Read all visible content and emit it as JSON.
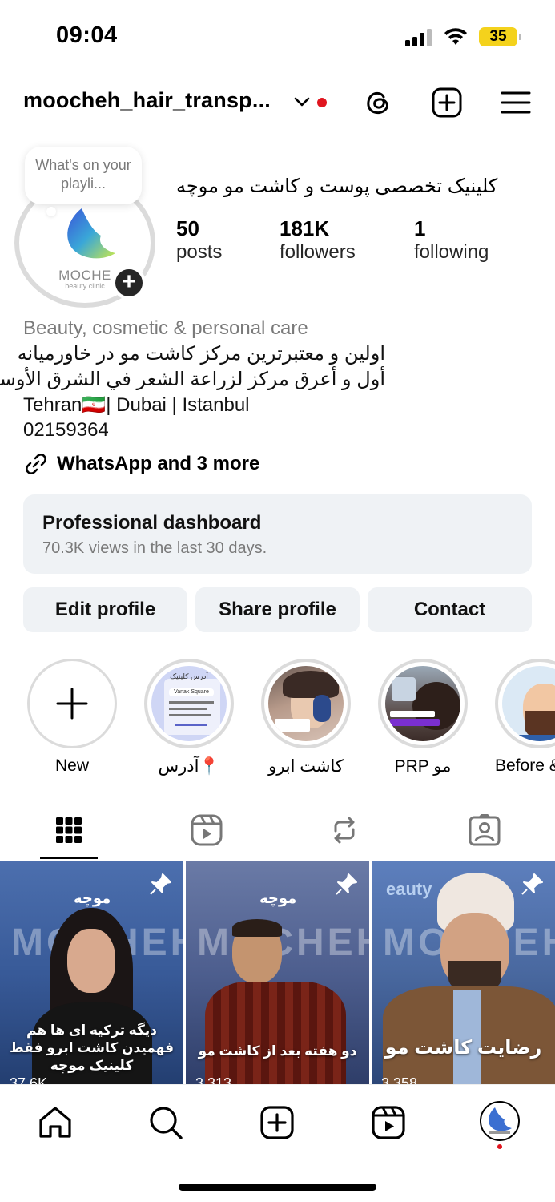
{
  "status_bar": {
    "time": "09:04",
    "battery": "35"
  },
  "header": {
    "username": "moocheh_hair_transp...",
    "icons": [
      "chevron-down-icon",
      "threads-icon",
      "create-post-icon",
      "menu-icon"
    ],
    "notification_color": "#e0151f"
  },
  "profile": {
    "note_bubble": "What's on your playli...",
    "avatar_brand": "MOCHE",
    "avatar_subtitle": "beauty clinic",
    "full_name": "کلینیک تخصصی پوست و کاشت مو موچه",
    "stats": [
      {
        "value": "50",
        "label": "posts"
      },
      {
        "value": "181K",
        "label": "followers"
      },
      {
        "value": "1",
        "label": "following"
      }
    ],
    "category": "Beauty, cosmetic & personal care",
    "bio_lines": [
      "اولین و معتبرترین مرکز کاشت مو در خاورمیانه",
      "أول و أعرق مركز لزراعة الشعر في الشرق الأوسط",
      "Tehran🇮🇷| Dubai | Istanbul",
      "02159364"
    ],
    "link_text": "WhatsApp and 3 more"
  },
  "dashboard": {
    "title": "Professional dashboard",
    "subtitle": "70.3K views in the last 30 days."
  },
  "buttons": {
    "edit": "Edit profile",
    "share": "Share profile",
    "contact": "Contact"
  },
  "highlights": [
    {
      "label": "New"
    },
    {
      "label": "آدرس📍"
    },
    {
      "label": "کاشت ابرو"
    },
    {
      "label": "PRP مو"
    },
    {
      "label": "Before &"
    }
  ],
  "highlight_texts": {
    "address_title": "آدرس کلینیک",
    "address_tag": "Vanak Square"
  },
  "tabs": [
    "grid-icon",
    "reels-icon",
    "reposts-icon",
    "tagged-icon"
  ],
  "posts": [
    {
      "logo": "موچه",
      "brand": "MOCHEH",
      "caption": "دیگه ترکیه ای ها هم فهمیدن کاشت ابرو فقط کلینیک موچه",
      "views": "37.6K"
    },
    {
      "logo": "موچه",
      "brand": "MOCHEH",
      "caption": "دو هفته بعد از کاشت مو",
      "views": "3,313"
    },
    {
      "logo": "eauty",
      "brand": "MOCHEH",
      "caption": "رضایت کاشت مو",
      "views": "3,358"
    }
  ],
  "navbar": [
    "home-icon",
    "search-icon",
    "create-icon",
    "reels-icon",
    "profile-avatar"
  ],
  "colors": {
    "accent_blue": "#3b6fd1",
    "button_bg": "#eff2f5",
    "muted_text": "#7a7a7a"
  }
}
